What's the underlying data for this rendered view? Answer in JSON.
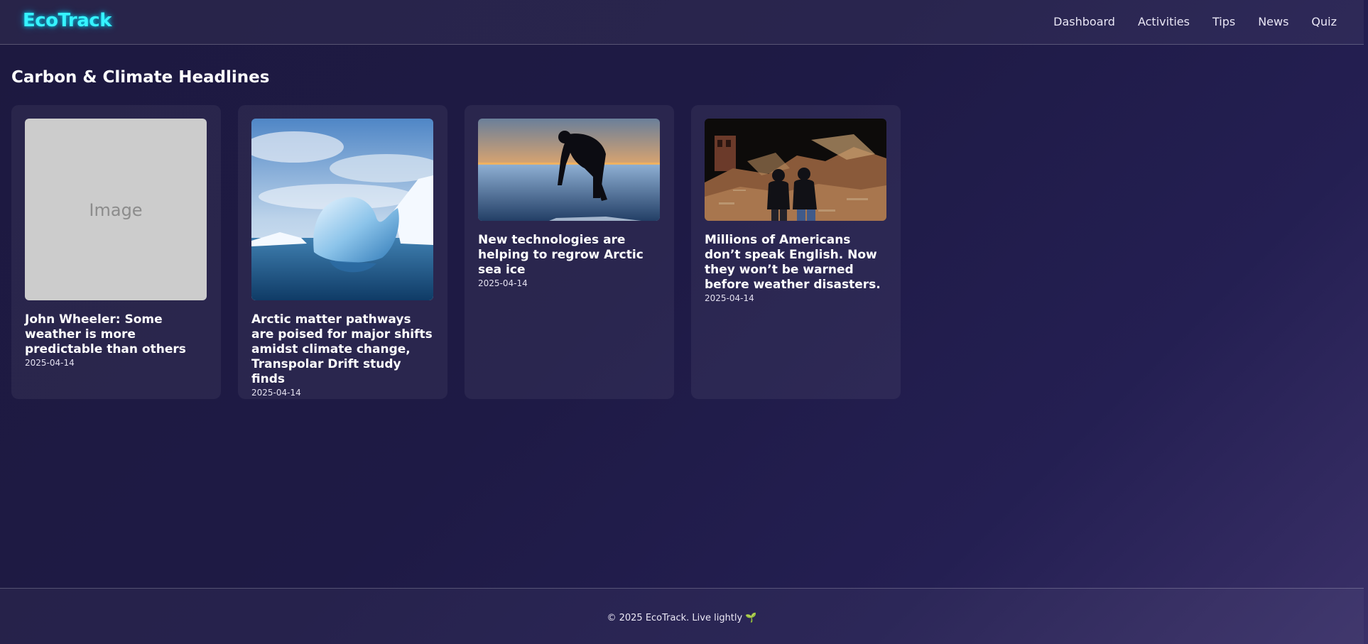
{
  "app": {
    "name": "EcoTrack"
  },
  "nav": {
    "items": [
      {
        "label": "Dashboard"
      },
      {
        "label": "Activities"
      },
      {
        "label": "Tips"
      },
      {
        "label": "News"
      },
      {
        "label": "Quiz"
      }
    ]
  },
  "main": {
    "title": "Carbon & Climate Headlines",
    "articles": [
      {
        "title": "John Wheeler: Some weather is more predictable than others",
        "date": "2025-04-14",
        "image": "placeholder",
        "image_label": "Image"
      },
      {
        "title": "Arctic matter pathways are poised for major shifts amidst climate change, Transpolar Drift study finds",
        "date": "2025-04-14",
        "image": "iceberg-photo"
      },
      {
        "title": "New technologies are helping to regrow Arctic sea ice",
        "date": "2025-04-14",
        "image": "sea-ice-sunset-photo"
      },
      {
        "title": "Millions of Americans don’t speak English. Now they won’t be warned before weather disasters.",
        "date": "2025-04-14",
        "image": "storm-damage-photo"
      }
    ]
  },
  "footer": {
    "text": "© 2025 EcoTrack. Live lightly 🌱"
  },
  "colors": {
    "logo": "#36f3ff",
    "background": "#1e1a45",
    "card": "#2a2550"
  }
}
